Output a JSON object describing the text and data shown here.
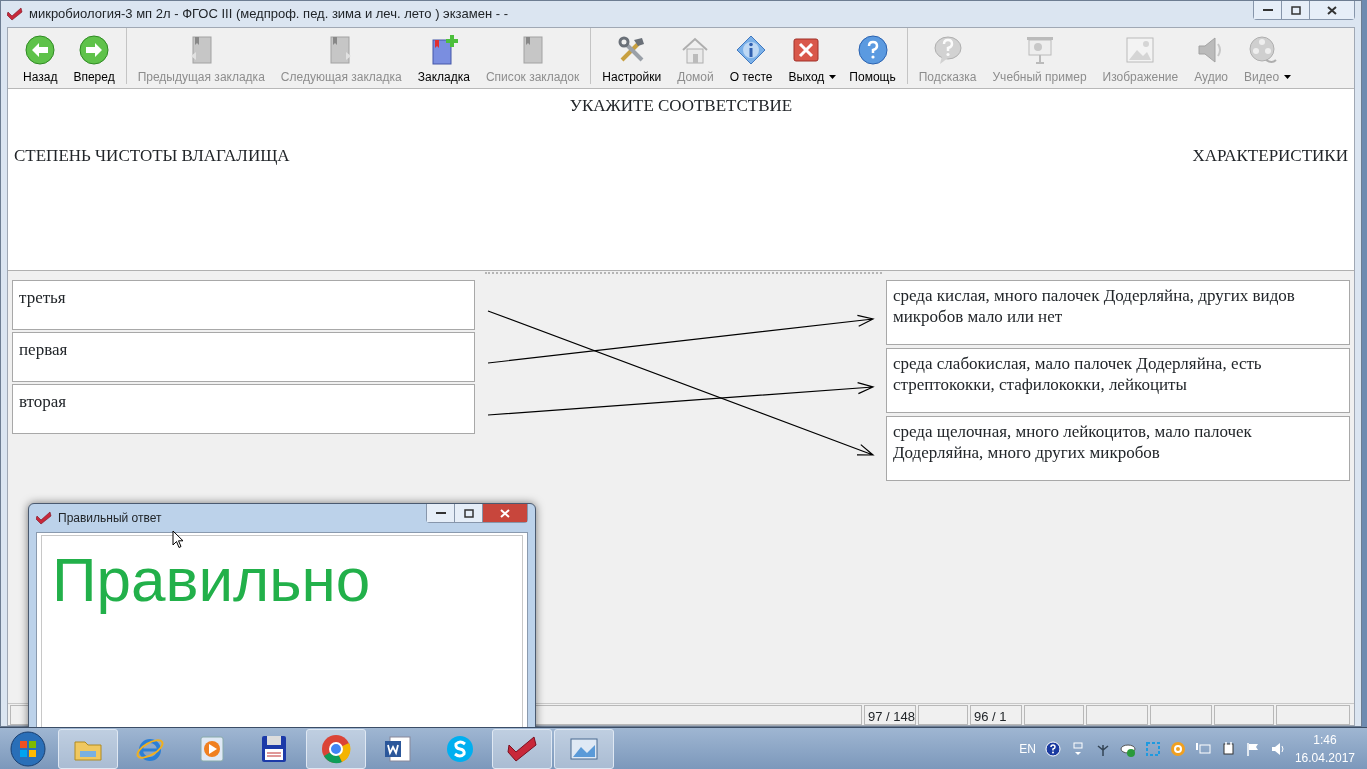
{
  "window": {
    "title": "микробиология-3 мп 2л - ФГОС III (медпроф. пед. зима и леч. лето ) экзамен -  -"
  },
  "toolbar": {
    "groups": [
      [
        {
          "label": "Назад",
          "disabled": false,
          "has_menu": false
        },
        {
          "label": "Вперед",
          "disabled": false,
          "has_menu": false
        }
      ],
      [
        {
          "label": "Предыдущая закладка",
          "disabled": true,
          "has_menu": false
        },
        {
          "label": "Следующая закладка",
          "disabled": true,
          "has_menu": false
        },
        {
          "label": "Закладка",
          "disabled": false,
          "has_menu": false
        },
        {
          "label": "Список закладок",
          "disabled": true,
          "has_menu": false
        }
      ],
      [
        {
          "label": "Настройки",
          "disabled": false,
          "has_menu": false
        },
        {
          "label": "Домой",
          "disabled": true,
          "has_menu": false
        },
        {
          "label": "О тесте",
          "disabled": false,
          "has_menu": false
        },
        {
          "label": "Выход",
          "disabled": false,
          "has_menu": true
        },
        {
          "label": "Помощь",
          "disabled": false,
          "has_menu": false
        }
      ],
      [
        {
          "label": "Подсказка",
          "disabled": true,
          "has_menu": false
        },
        {
          "label": "Учебный пример",
          "disabled": true,
          "has_menu": false
        },
        {
          "label": "Изображение",
          "disabled": true,
          "has_menu": false
        },
        {
          "label": "Аудио",
          "disabled": true,
          "has_menu": false
        },
        {
          "label": "Видео",
          "disabled": true,
          "has_menu": true
        }
      ]
    ]
  },
  "question": {
    "title": "УКАЖИТЕ СООТВЕТСТВИЕ",
    "left_heading": "СТЕПЕНЬ ЧИСТОТЫ ВЛАГАЛИЩА",
    "right_heading": "ХАРАКТЕРИСТИКИ"
  },
  "matching": {
    "left": [
      {
        "text": "третья",
        "connected_to": [
          false,
          false,
          true
        ]
      },
      {
        "text": "первая",
        "connected_to": [
          true,
          false,
          false
        ]
      },
      {
        "text": "вторая",
        "connected_to": [
          false,
          true,
          false
        ]
      }
    ],
    "right": [
      {
        "text": "среда кислая, много палочек Додерляйна, других видов микробов мало или нет"
      },
      {
        "text": "среда слабокислая, мало палочек Додерляйна, есть стрептококки, стафилококки, лейкоциты"
      },
      {
        "text": "среда щелочная, много лейкоцитов, мало палочек Додерляйна, много других микробов"
      }
    ]
  },
  "status_bar": {
    "cells": [
      {},
      {
        "text": "97 / 148"
      },
      {},
      {
        "text": "96 / 1"
      },
      {},
      {},
      {},
      {},
      {}
    ]
  },
  "dialog": {
    "title": "Правильный ответ",
    "message": "Правильно"
  },
  "taskbar": {
    "items": [
      {
        "open": true
      },
      {
        "open": false
      },
      {
        "open": false
      },
      {
        "open": false
      },
      {
        "open": true
      },
      {
        "open": false
      },
      {
        "open": false
      },
      {
        "open": true
      },
      {
        "open": true
      }
    ],
    "tray": {
      "language": "EN",
      "time": "1:46",
      "date": "16.04.2017"
    }
  }
}
